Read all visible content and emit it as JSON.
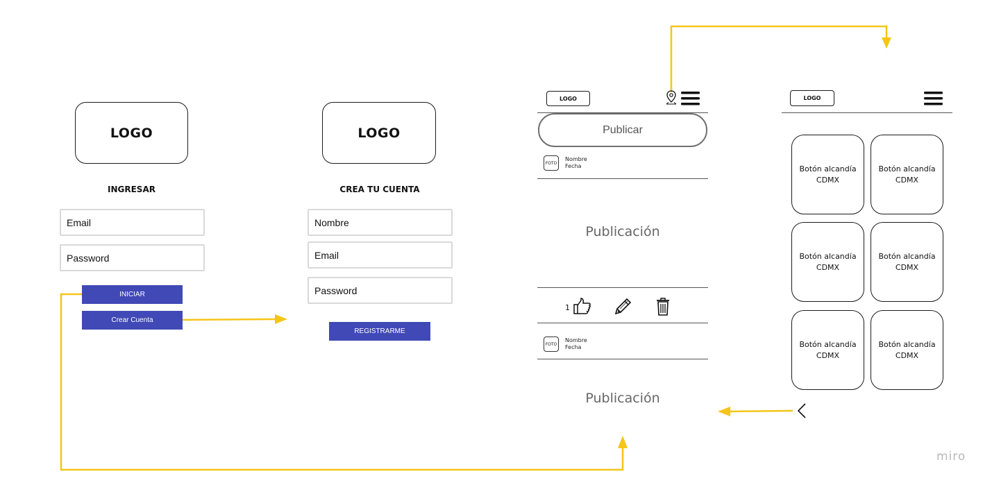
{
  "login": {
    "logo": "LOGO",
    "heading": "INGRESAR",
    "email_placeholder": "Email",
    "password_placeholder": "Password",
    "login_button": "INICIAR",
    "create_account_button": "Crear Cuenta"
  },
  "register": {
    "logo": "LOGO",
    "heading": "CREA TU CUENTA",
    "name_placeholder": "Nombre",
    "email_placeholder": "Email",
    "password_placeholder": "Password",
    "register_button": "REGISTRARME"
  },
  "feed": {
    "logo": "LOGO",
    "publish_button": "Publicar",
    "posts": [
      {
        "photo": "FOTO",
        "name": "Nombre",
        "date": "Fecha",
        "content": "Publicación",
        "likes": "1"
      },
      {
        "photo": "FOTO",
        "name": "Nombre",
        "date": "Fecha",
        "content": "Publicación"
      }
    ],
    "icons": [
      "location-pin-icon",
      "hamburger-menu-icon",
      "thumbs-up-icon",
      "pencil-icon",
      "trash-icon"
    ]
  },
  "menu": {
    "logo": "LOGO",
    "tiles": [
      {
        "line1": "Botón alcandía",
        "line2": "CDMX"
      },
      {
        "line1": "Botón alcandía",
        "line2": "CDMX"
      },
      {
        "line1": "Botón alcandía",
        "line2": "CDMX"
      },
      {
        "line1": "Botón alcandía",
        "line2": "CDMX"
      },
      {
        "line1": "Botón alcandía",
        "line2": "CDMX"
      },
      {
        "line1": "Botón alcandía",
        "line2": "CDMX"
      }
    ],
    "icons": [
      "hamburger-menu-icon",
      "back-chevron-icon"
    ]
  },
  "colors": {
    "arrow": "#f5c518",
    "button": "#4149b6"
  },
  "watermark": "miro"
}
